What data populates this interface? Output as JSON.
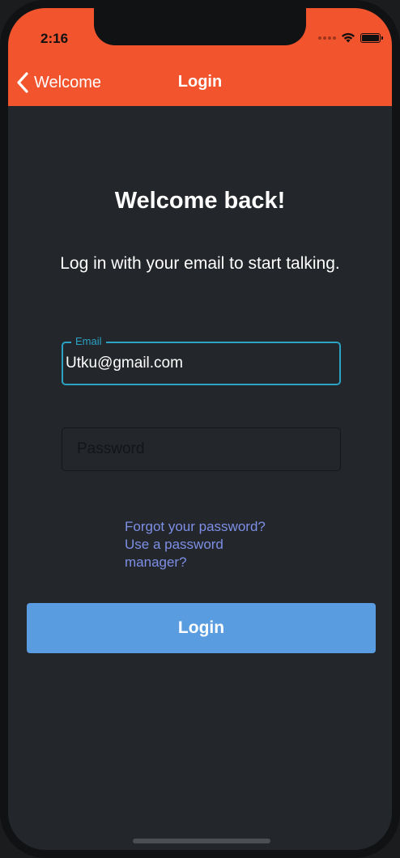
{
  "status_bar": {
    "time": "2:16"
  },
  "nav": {
    "back_label": "Welcome",
    "title": "Login"
  },
  "main": {
    "headline": "Welcome back!",
    "subtitle": "Log in with your email to start talking."
  },
  "form": {
    "email_label": "Email",
    "email_value": "Utku@gmail.com",
    "password_placeholder": "Password",
    "password_value": "",
    "forgot_password_link": "Forgot your password?",
    "password_manager_link": "Use a password manager?",
    "login_button": "Login"
  },
  "colors": {
    "header": "#f2542d",
    "background": "#23262a",
    "accent": "#2aa3c4",
    "link": "#7d8fe6",
    "button": "#5a9ce0"
  },
  "icons": {
    "back": "chevron-left-icon",
    "wifi": "wifi-icon",
    "battery": "battery-icon",
    "signal": "signal-icon"
  }
}
